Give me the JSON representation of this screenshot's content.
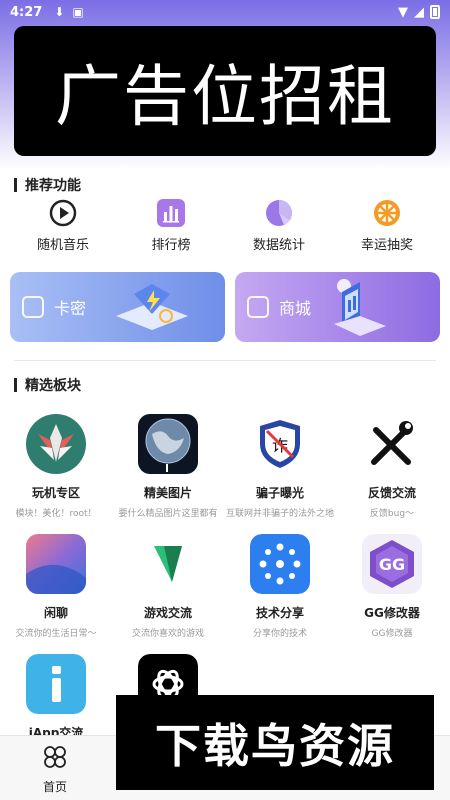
{
  "status_bar": {
    "time": "4:27"
  },
  "ad_banner": {
    "text": "广告位招租"
  },
  "recommended": {
    "title": "推荐功能",
    "items": [
      {
        "label": "随机音乐",
        "icon": "play-circle-icon"
      },
      {
        "label": "排行榜",
        "icon": "bar-chart-icon"
      },
      {
        "label": "数据统计",
        "icon": "pie-chart-icon"
      },
      {
        "label": "幸运抽奖",
        "icon": "wheel-icon"
      }
    ]
  },
  "cards": [
    {
      "label": "卡密",
      "icon": "card-key-icon"
    },
    {
      "label": "商城",
      "icon": "shop-icon"
    }
  ],
  "boards": {
    "title": "精选板块",
    "items": [
      {
        "name": "玩机专区",
        "desc": "模块！美化！root！"
      },
      {
        "name": "精美图片",
        "desc": "要什么精品图片这里都有"
      },
      {
        "name": "骗子曝光",
        "desc": "互联网并非骗子的法外之地"
      },
      {
        "name": "反馈交流",
        "desc": "反馈bug～"
      },
      {
        "name": "闲聊",
        "desc": "交流你的生活日常～"
      },
      {
        "name": "游戏交流",
        "desc": "交流你喜欢的游戏"
      },
      {
        "name": "技术分享",
        "desc": "分享你的技术"
      },
      {
        "name": "GG修改器",
        "desc": "GG修改器"
      },
      {
        "name": "iApp交流",
        "desc": ""
      },
      {
        "name": "",
        "desc": ""
      }
    ]
  },
  "tabbar": {
    "home_label": "首页"
  },
  "watermark": {
    "text": "下载鸟资源"
  }
}
